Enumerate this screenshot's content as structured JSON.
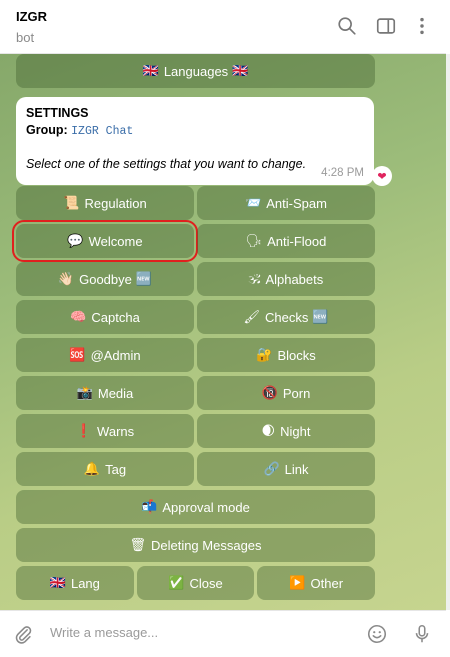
{
  "header": {
    "title": "IZGR",
    "subtitle": "bot",
    "icons": [
      "search-icon",
      "side-panel-icon",
      "more-vertical-icon"
    ]
  },
  "keyboard_top": {
    "label": "Languages",
    "emoji_left": "🇬🇧",
    "emoji_right": "🇬🇧"
  },
  "message": {
    "title": "SETTINGS",
    "group_label": "Group:",
    "group_value": "IZGR Chat",
    "note": "Select one of the settings that you want to change.",
    "time": "4:28 PM",
    "reaction": "❤"
  },
  "keyboard": {
    "regulation": {
      "emoji": "📜",
      "label": "Regulation"
    },
    "anti_spam": {
      "emoji": "📨",
      "label": "Anti-Spam"
    },
    "welcome": {
      "emoji": "💬",
      "label": "Welcome"
    },
    "anti_flood": {
      "emoji": "🗣",
      "label": "Anti-Flood"
    },
    "goodbye": {
      "emoji": "👋🏻",
      "label": "Goodbye",
      "tail": "🆕"
    },
    "alphabets": {
      "emoji": "🕉",
      "label": "Alphabets"
    },
    "captcha": {
      "emoji": "🧠",
      "label": "Captcha"
    },
    "checks": {
      "emoji": "🖌",
      "label": "Checks",
      "tail": "🆕"
    },
    "admin": {
      "emoji": "🆘",
      "label": "@Admin"
    },
    "blocks": {
      "emoji": "🔐",
      "label": "Blocks"
    },
    "media": {
      "emoji": "📸",
      "label": "Media"
    },
    "porn": {
      "emoji": "🔞",
      "label": "Porn"
    },
    "warns": {
      "emoji": "❗",
      "label": "Warns"
    },
    "night": {
      "emoji": "🌒",
      "label": "Night"
    },
    "tag": {
      "emoji": "🔔",
      "label": "Tag"
    },
    "link": {
      "emoji": "🔗",
      "label": "Link"
    },
    "approval": {
      "emoji": "📬",
      "label": "Approval mode"
    },
    "deleting": {
      "emoji": "🗑",
      "label": "Deleting Messages"
    },
    "lang": {
      "emoji": "🇬🇧",
      "label": "Lang"
    },
    "close": {
      "emoji": "✅",
      "label": "Close"
    },
    "other": {
      "emoji": "▶️",
      "label": "Other"
    }
  },
  "footer": {
    "placeholder": "Write a message...",
    "icons": [
      "attach-icon",
      "emoji-icon",
      "microphone-icon"
    ]
  },
  "colors": {
    "highlight": "#e0201e",
    "chat_background": "#9cbc7a",
    "button_background": "rgba(70,100,50,0.42)",
    "group_link": "#3a6da8"
  }
}
